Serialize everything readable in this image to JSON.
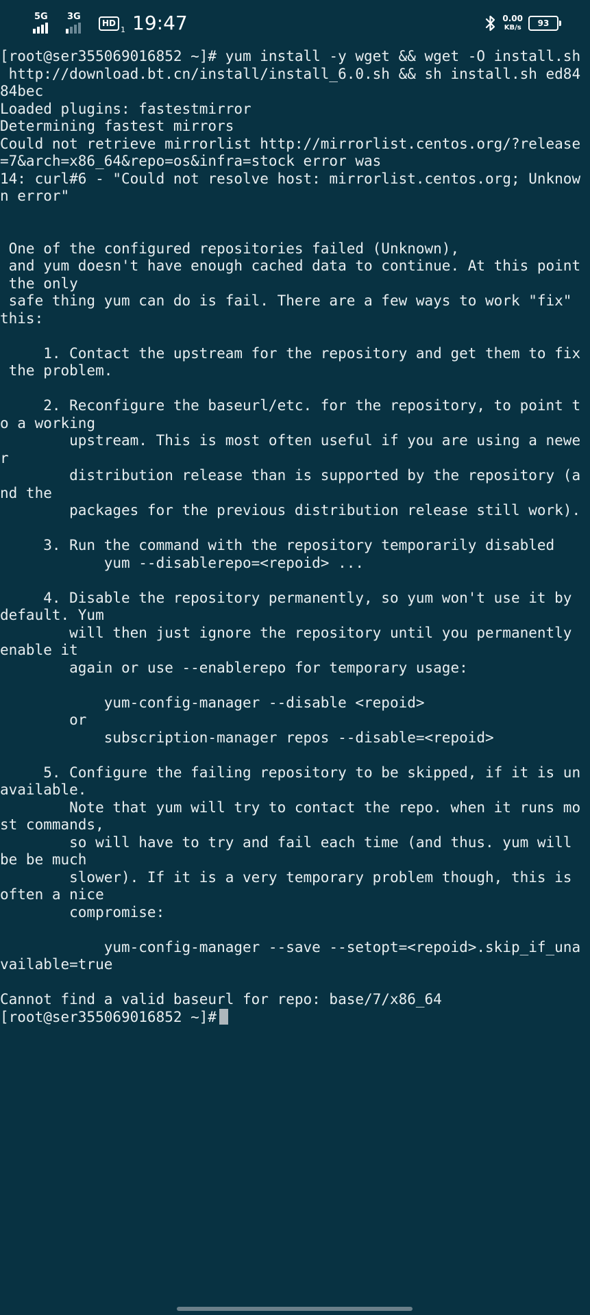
{
  "status_bar": {
    "signal_1_label": "5G",
    "signal_2_label": "3G",
    "hd_label": "HD",
    "hd_sub": "1",
    "time": "19:47",
    "speed_value": "0.00",
    "speed_unit": "KB/s",
    "battery_level": "93",
    "icons": [
      "signal-icon",
      "signal-icon",
      "hd-icon",
      "bluetooth-icon",
      "battery-icon"
    ]
  },
  "terminal": {
    "lines": [
      "[root@ser355069016852 ~]# yum install -y wget && wget -O install.sh",
      " http://download.bt.cn/install/install_6.0.sh && sh install.sh ed84",
      "84bec",
      "Loaded plugins: fastestmirror",
      "Determining fastest mirrors",
      "Could not retrieve mirrorlist http://mirrorlist.centos.org/?release",
      "=7&arch=x86_64&repo=os&infra=stock error was",
      "14: curl#6 - \"Could not resolve host: mirrorlist.centos.org; Unknow",
      "n error\"",
      "",
      "",
      " One of the configured repositories failed (Unknown),",
      " and yum doesn't have enough cached data to continue. At this point",
      " the only",
      " safe thing yum can do is fail. There are a few ways to work \"fix\"",
      "this:",
      "",
      "     1. Contact the upstream for the repository and get them to fix",
      " the problem.",
      "",
      "     2. Reconfigure the baseurl/etc. for the repository, to point t",
      "o a working",
      "        upstream. This is most often useful if you are using a newe",
      "r",
      "        distribution release than is supported by the repository (a",
      "nd the",
      "        packages for the previous distribution release still work).",
      "",
      "     3. Run the command with the repository temporarily disabled",
      "            yum --disablerepo=<repoid> ...",
      "",
      "     4. Disable the repository permanently, so yum won't use it by",
      "default. Yum",
      "        will then just ignore the repository until you permanently",
      "enable it",
      "        again or use --enablerepo for temporary usage:",
      "",
      "            yum-config-manager --disable <repoid>",
      "        or",
      "            subscription-manager repos --disable=<repoid>",
      "",
      "     5. Configure the failing repository to be skipped, if it is un",
      "available.",
      "        Note that yum will try to contact the repo. when it runs mo",
      "st commands,",
      "        so will have to try and fail each time (and thus. yum will",
      "be be much",
      "        slower). If it is a very temporary problem though, this is",
      "often a nice",
      "        compromise:",
      "",
      "            yum-config-manager --save --setopt=<repoid>.skip_if_una",
      "vailable=true",
      "",
      "Cannot find a valid baseurl for repo: base/7/x86_64"
    ],
    "prompt": "[root@ser355069016852 ~]#"
  },
  "colors": {
    "background": "#083242",
    "text": "#e8eef0",
    "cursor": "#aeb7bc"
  }
}
